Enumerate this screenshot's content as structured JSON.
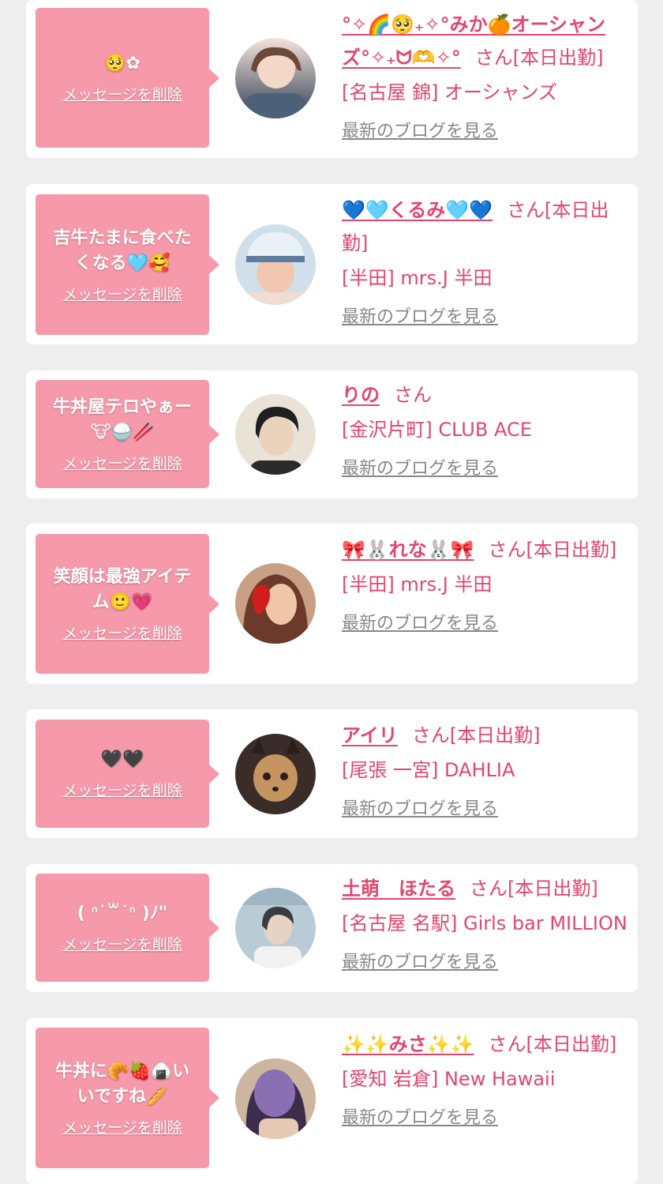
{
  "common": {
    "delete_label": "メッセージを削除",
    "blog_label": "最新のブログを見る"
  },
  "colors": {
    "page_bg": "#eeeeee",
    "card_bg": "#ffffff",
    "bubble_bg": "#f69aab",
    "accent_pink": "#e2466d",
    "link_gray": "#888888"
  },
  "messages": [
    {
      "text": "🥺✿",
      "name": "°✧🌈🥺₊✧°みか🍊オーシャンズ°✧₊ᗢ🫶✧°",
      "suffix": "さん[本日出勤]",
      "shop": "[名古屋 錦] オーシャンズ",
      "avatar_colors": [
        "#f3d8c8",
        "#4c6078",
        "#2e3f55"
      ]
    },
    {
      "text": "吉牛たまに食べたくなる🩵🥰",
      "name": "💙🩵くるみ🩵💙",
      "suffix": "さん[本日出勤]",
      "shop": "[半田] mrs.J 半田",
      "avatar_colors": [
        "#dbe8f0",
        "#f1c7b2",
        "#5e7da0"
      ]
    },
    {
      "text": "牛丼屋テロやぁー🐮🍚🥢",
      "name": "りの",
      "suffix": "さん",
      "shop": "[金沢片町] CLUB ACE",
      "avatar_colors": [
        "#e9e2d6",
        "#1f1f1f",
        "#cfbba3"
      ]
    },
    {
      "text": "笑顔は最強アイテム🙂💗",
      "name": "🎀🐰れな🐰🎀",
      "suffix": "さん[本日出勤]",
      "shop": "[半田] mrs.J 半田",
      "avatar_colors": [
        "#d89a7a",
        "#b9432e",
        "#6b3a2a"
      ]
    },
    {
      "text": "🖤🖤",
      "name": "アイリ",
      "suffix": "さん[本日出勤]",
      "shop": "[尾張 一宮] DAHLIA",
      "avatar_colors": [
        "#c59460",
        "#3a2d28",
        "#8b6a4b"
      ]
    },
    {
      "text": "( ᐢ˙꒳˙ᐢ )ﾉ\"",
      "name": "土萌　ほたる",
      "suffix": "さん[本日出勤]",
      "shop": "[名古屋 名駅] Girls bar MILLION",
      "avatar_colors": [
        "#b9ccd6",
        "#e7d3c4",
        "#6c8598"
      ]
    },
    {
      "text": "牛丼に🥐🍓🍙いいですね🥖",
      "name": "✨✨みさ✨✨",
      "suffix": "さん[本日出勤]",
      "shop": "[愛知 岩倉] New Hawaii",
      "avatar_colors": [
        "#8a6fb3",
        "#e6c9b2",
        "#3c2d4a"
      ]
    }
  ]
}
